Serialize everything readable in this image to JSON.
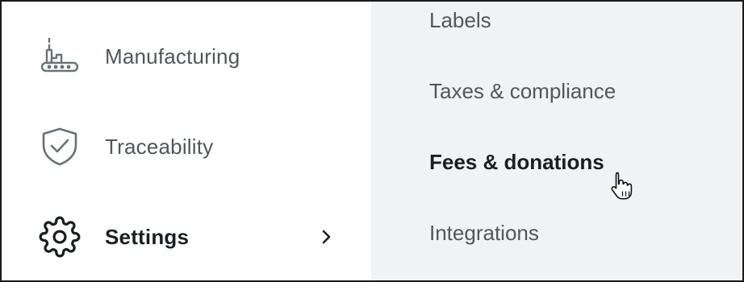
{
  "nav": {
    "items": [
      {
        "label": "Manufacturing",
        "icon": "factory-icon",
        "active": false
      },
      {
        "label": "Traceability",
        "icon": "shield-check-icon",
        "active": false
      },
      {
        "label": "Settings",
        "icon": "gear-icon",
        "active": true,
        "has_submenu": true
      }
    ]
  },
  "submenu": {
    "items": [
      {
        "label": "Labels",
        "active": false
      },
      {
        "label": "Taxes & compliance",
        "active": false
      },
      {
        "label": "Fees & donations",
        "active": true
      },
      {
        "label": "Integrations",
        "active": false
      }
    ]
  },
  "colors": {
    "text_muted": "#51575a",
    "text_active": "#1c1f21",
    "submenu_bg": "#f1f2f4",
    "border": "#1a1a1a"
  },
  "cursor": {
    "icon": "hand-pointer-icon"
  }
}
